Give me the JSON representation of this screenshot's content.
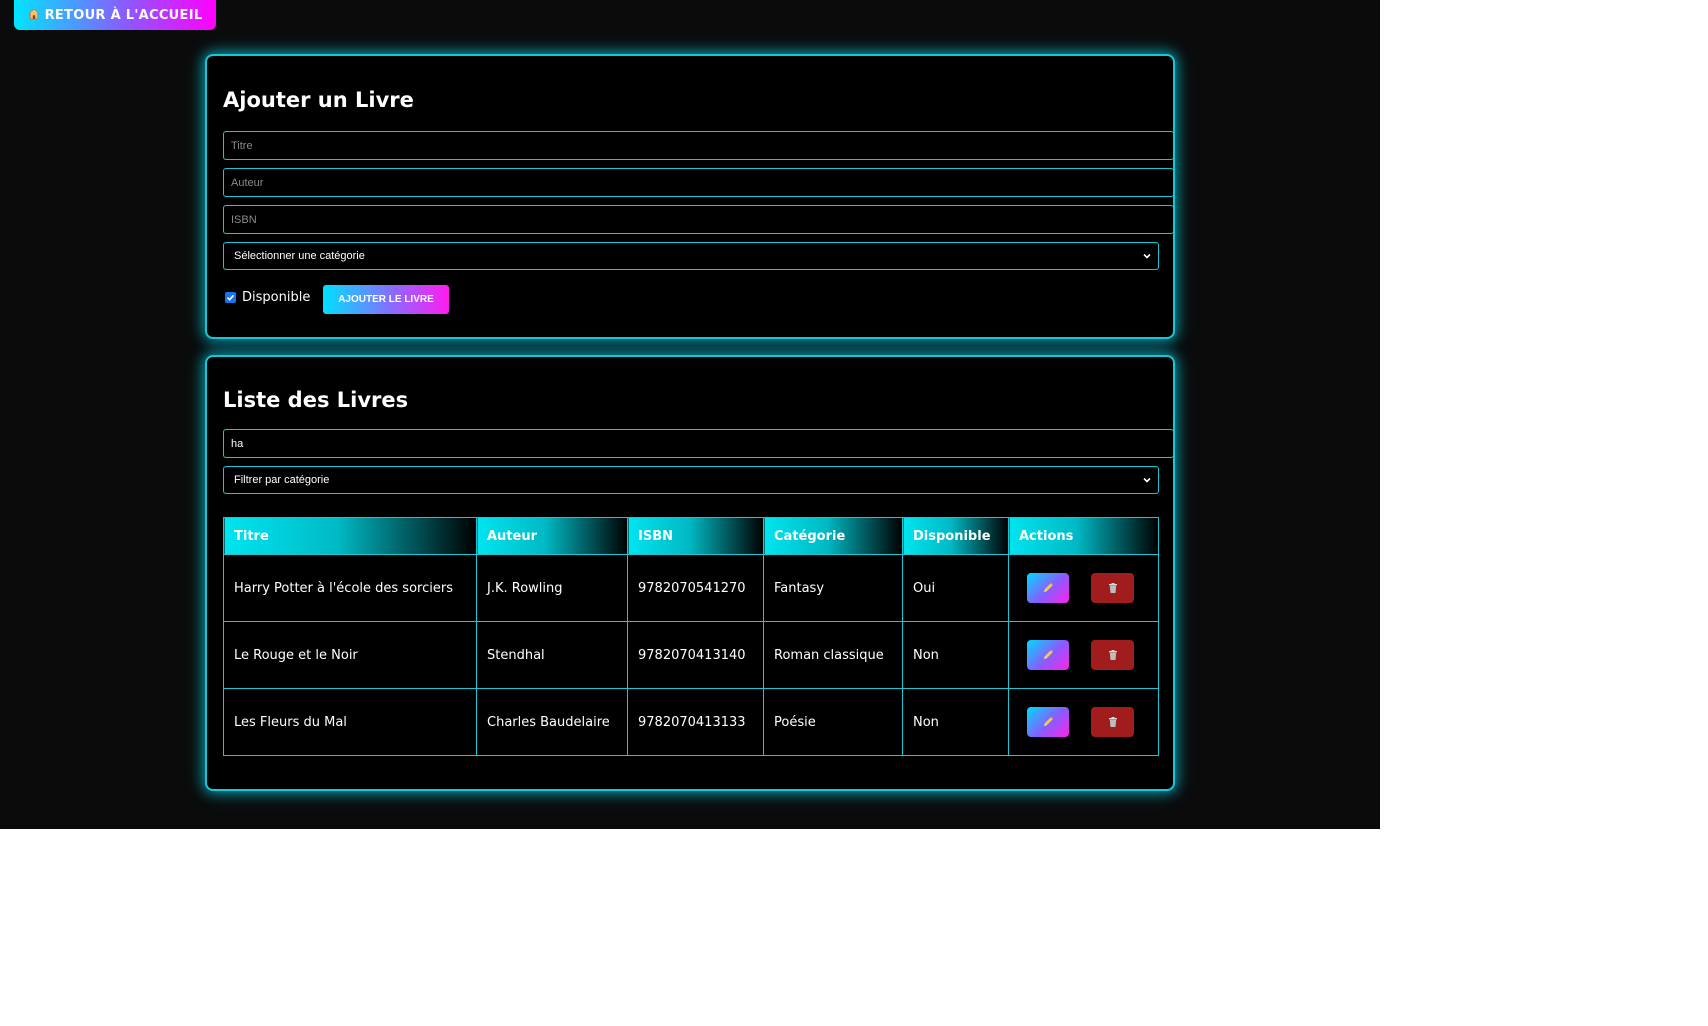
{
  "nav": {
    "home_label": "RETOUR À L'ACCUEIL",
    "home_icon": "house-icon"
  },
  "add_form": {
    "title": "Ajouter un Livre",
    "title_placeholder": "Titre",
    "author_placeholder": "Auteur",
    "isbn_placeholder": "ISBN",
    "category_select": "Sélectionner une catégorie",
    "available_label": "Disponible",
    "available_checked": true,
    "submit_label": "AJOUTER LE LIVRE"
  },
  "book_list": {
    "title": "Liste des Livres",
    "search_value": "ha",
    "category_filter": "Filtrer par catégorie",
    "columns": [
      "Titre",
      "Auteur",
      "ISBN",
      "Catégorie",
      "Disponible",
      "Actions"
    ],
    "rows": [
      {
        "title": "Harry Potter à l'école des sorciers",
        "author": "J.K. Rowling",
        "isbn": "9782070541270",
        "category": "Fantasy",
        "available": "Oui"
      },
      {
        "title": "Le Rouge et le Noir",
        "author": "Stendhal",
        "isbn": "9782070413140",
        "category": "Roman classique",
        "available": "Non"
      },
      {
        "title": "Les Fleurs du Mal",
        "author": "Charles Baudelaire",
        "isbn": "9782070413133",
        "category": "Poésie",
        "available": "Non"
      }
    ]
  },
  "theme": {
    "accent": "#17c7d6",
    "gradient_start": "#00e5ff",
    "gradient_end": "#ff00ff",
    "delete_color": "#a11d1d",
    "background": "#0b0b0b"
  }
}
